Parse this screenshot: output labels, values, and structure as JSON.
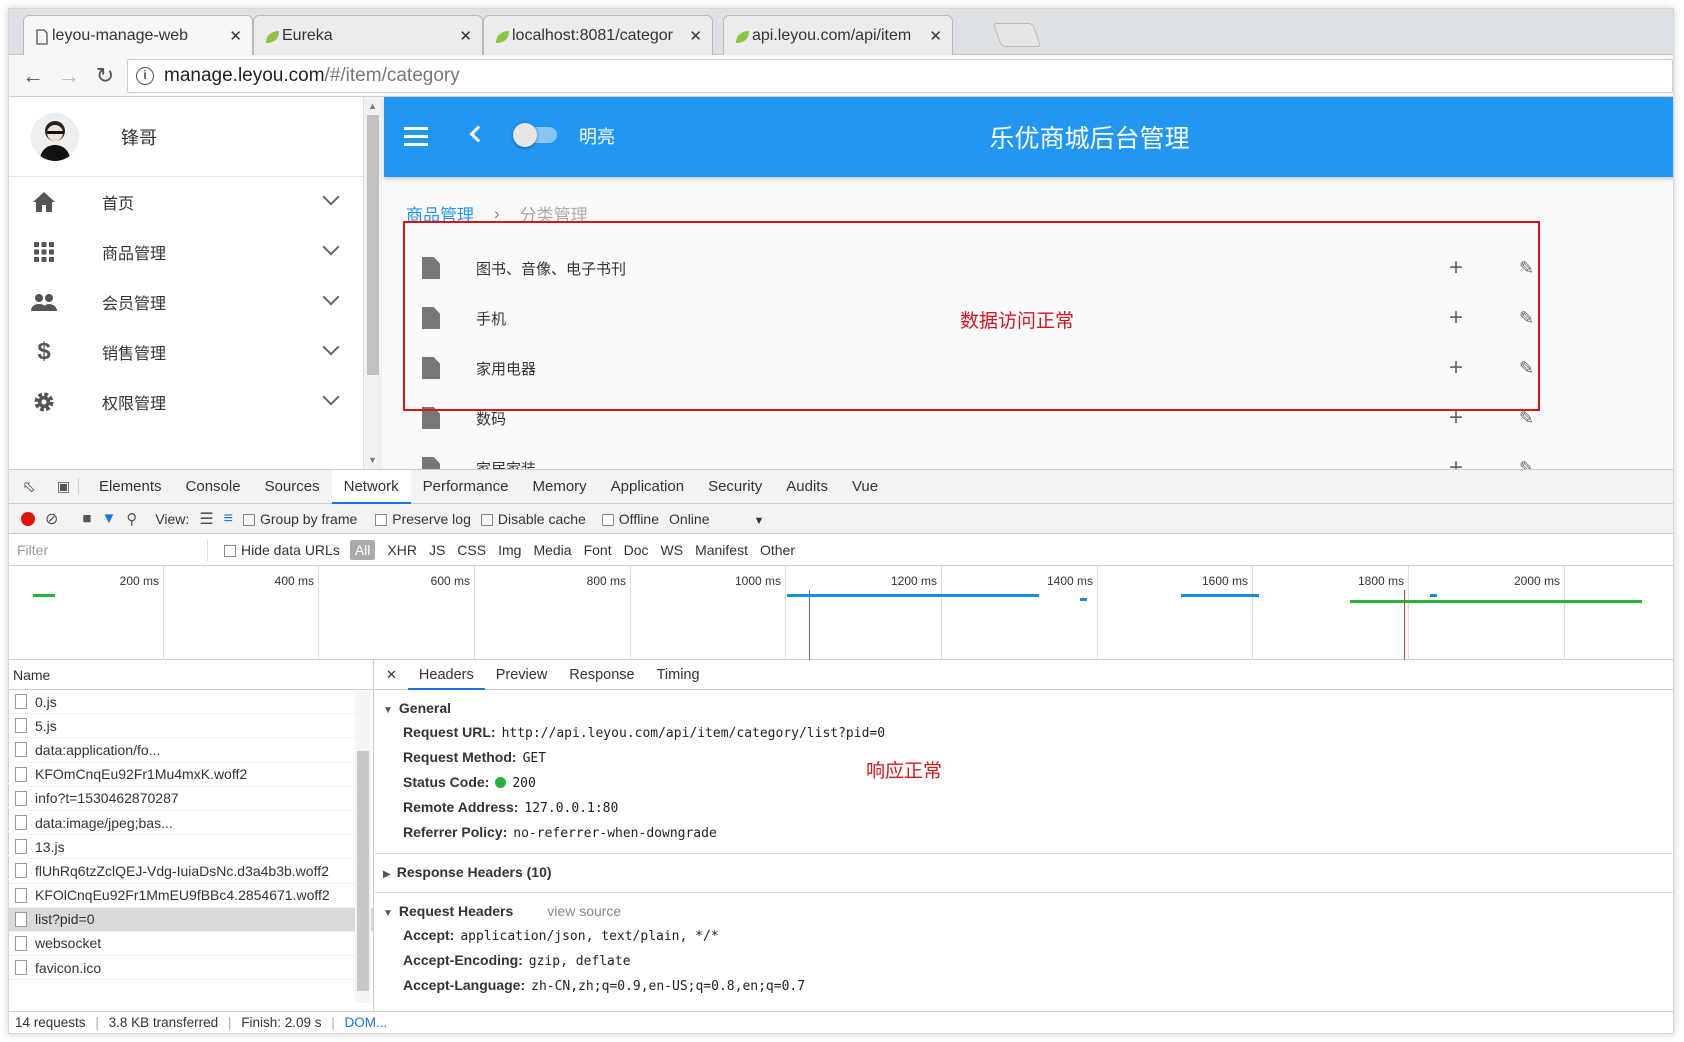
{
  "browser": {
    "tabs": [
      {
        "title": "leyou-manage-web",
        "icon": "page-icon"
      },
      {
        "title": "Eureka",
        "icon": "leaf-icon"
      },
      {
        "title": "localhost:8081/categor",
        "icon": "leaf-icon"
      },
      {
        "title": "api.leyou.com/api/item",
        "icon": "leaf-icon"
      }
    ],
    "close_glyph": "✕",
    "url_host": "manage.leyou.com",
    "url_path": "/#/item/category"
  },
  "sidebar": {
    "username": "锋哥",
    "items": [
      {
        "label": "首页",
        "icon": "home-icon"
      },
      {
        "label": "商品管理",
        "icon": "apps-icon"
      },
      {
        "label": "会员管理",
        "icon": "people-icon"
      },
      {
        "label": "销售管理",
        "icon": "dollar-icon"
      },
      {
        "label": "权限管理",
        "icon": "gear-icon"
      }
    ]
  },
  "topbar": {
    "toggle_label": "明亮",
    "title": "乐优商城后台管理"
  },
  "breadcrumb": {
    "first": "商品管理",
    "separator": "›",
    "current": "分类管理"
  },
  "tree": {
    "items": [
      "图书、音像、电子书刊",
      "手机",
      "家用电器",
      "数码",
      "家居家装"
    ],
    "add_glyph": "+",
    "edit_glyph": "✎"
  },
  "annotations": {
    "data_ok": "数据访问正常",
    "response_ok": "响应正常"
  },
  "devtools": {
    "tabs": [
      "Elements",
      "Console",
      "Sources",
      "Network",
      "Performance",
      "Memory",
      "Application",
      "Security",
      "Audits",
      "Vue"
    ],
    "active_tab": "Network",
    "toolbar": {
      "view_label": "View:",
      "group_by_frame": "Group by frame",
      "preserve_log": "Preserve log",
      "disable_cache": "Disable cache",
      "offline": "Offline",
      "throttle": "Online"
    },
    "filter": {
      "placeholder": "Filter",
      "hide_data_urls": "Hide data URLs",
      "types": [
        "All",
        "XHR",
        "JS",
        "CSS",
        "Img",
        "Media",
        "Font",
        "Doc",
        "WS",
        "Manifest",
        "Other"
      ]
    },
    "timeline_ticks": [
      "200 ms",
      "400 ms",
      "600 ms",
      "800 ms",
      "1000 ms",
      "1200 ms",
      "1400 ms",
      "1600 ms",
      "1800 ms",
      "2000 ms"
    ],
    "requests_header": "Name",
    "requests": [
      "0.js",
      "5.js",
      "data:application/fo...",
      "KFOmCnqEu92Fr1Mu4mxK.woff2",
      "info?t=1530462870287",
      "data:image/jpeg;bas...",
      "13.js",
      "flUhRq6tzZclQEJ-Vdg-IuiaDsNc.d3a4b3b.woff2",
      "KFOlCnqEu92Fr1MmEU9fBBc4.2854671.woff2",
      "list?pid=0",
      "websocket",
      "favicon.ico"
    ],
    "selected_request": "list?pid=0",
    "status": {
      "requests": "14 requests",
      "transferred": "3.8 KB transferred",
      "finish": "Finish: 2.09 s",
      "dom": "DOM..."
    },
    "detail_tabs": [
      "Headers",
      "Preview",
      "Response",
      "Timing"
    ],
    "general": {
      "title": "General",
      "request_url_k": "Request URL:",
      "request_url_v": "http://api.leyou.com/api/item/category/list?pid=0",
      "method_k": "Request Method:",
      "method_v": "GET",
      "status_k": "Status Code:",
      "status_v": "200",
      "remote_k": "Remote Address:",
      "remote_v": "127.0.0.1:80",
      "referrer_k": "Referrer Policy:",
      "referrer_v": "no-referrer-when-downgrade"
    },
    "response_headers": "Response Headers (10)",
    "request_headers": {
      "title": "Request Headers",
      "view_source": "view source",
      "accept_k": "Accept:",
      "accept_v": "application/json, text/plain, */*",
      "encoding_k": "Accept-Encoding:",
      "encoding_v": "gzip, deflate",
      "language_k": "Accept-Language:",
      "language_v": "zh-CN,zh;q=0.9,en-US;q=0.8,en;q=0.7"
    }
  }
}
